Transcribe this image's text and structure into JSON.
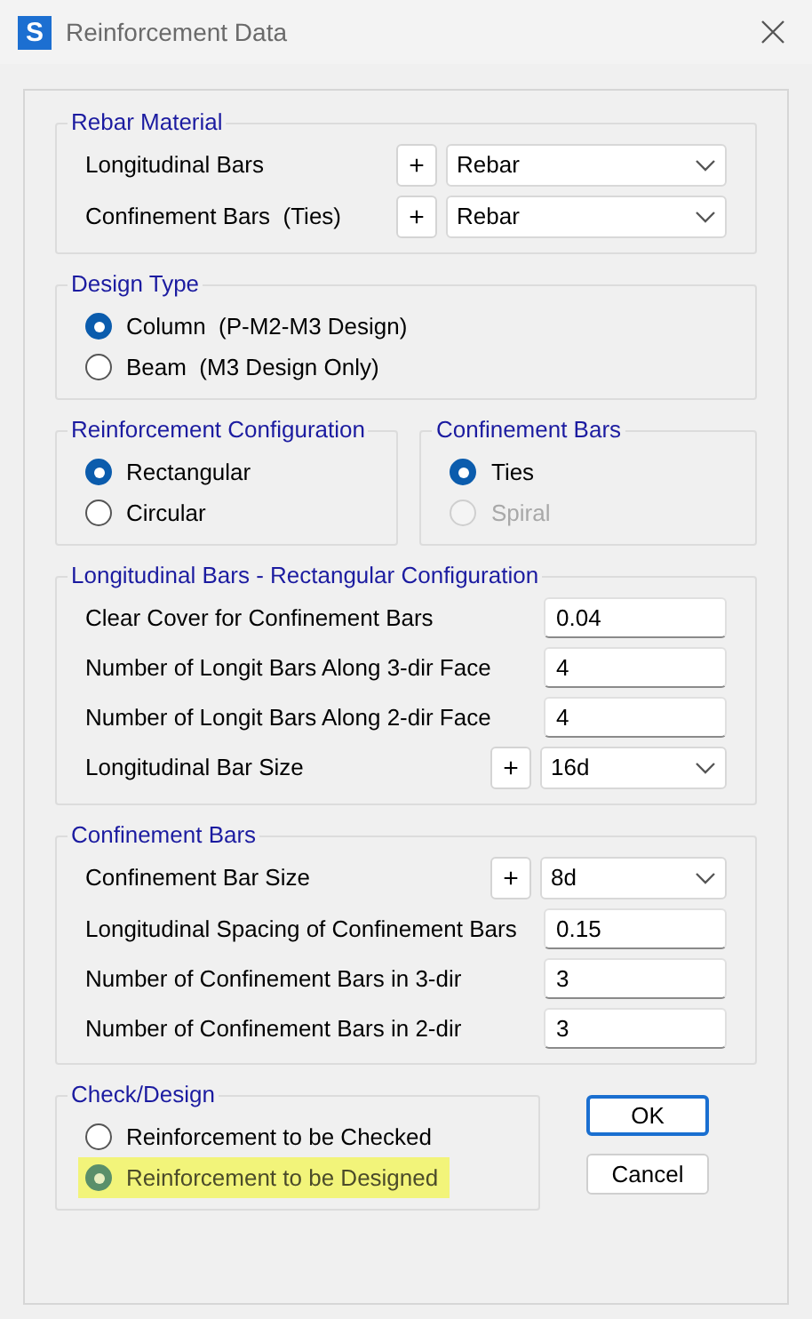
{
  "window": {
    "title": "Reinforcement Data",
    "icon_letter": "S"
  },
  "rebar_material": {
    "title": "Rebar Material",
    "rows": [
      {
        "kind": "dropdown",
        "label": "Longitudinal Bars",
        "add": "+",
        "value": "Rebar"
      },
      {
        "kind": "dropdown",
        "label": "Confinement Bars  (Ties)",
        "add": "+",
        "value": "Rebar"
      }
    ]
  },
  "design_type": {
    "title": "Design Type",
    "options": [
      {
        "label": "Column  (P-M2-M3 Design)",
        "selected": true,
        "disabled": false,
        "highlighted": false
      },
      {
        "label": "Beam  (M3 Design Only)",
        "selected": false,
        "disabled": false,
        "highlighted": false
      }
    ]
  },
  "reinforcement_configuration": {
    "title": "Reinforcement Configuration",
    "options": [
      {
        "label": "Rectangular",
        "selected": true,
        "disabled": false,
        "highlighted": false
      },
      {
        "label": "Circular",
        "selected": false,
        "disabled": false,
        "highlighted": false
      }
    ]
  },
  "confinement_type": {
    "title": "Confinement Bars",
    "options": [
      {
        "label": "Ties",
        "selected": true,
        "disabled": false,
        "highlighted": false
      },
      {
        "label": "Spiral",
        "selected": false,
        "disabled": true,
        "highlighted": false
      }
    ]
  },
  "longitudinal_bars": {
    "title": "Longitudinal Bars - Rectangular Configuration",
    "rows": [
      {
        "kind": "input",
        "label": "Clear Cover for Confinement Bars",
        "value": "0.04"
      },
      {
        "kind": "input",
        "label": "Number of Longit Bars Along 3-dir Face",
        "value": "4"
      },
      {
        "kind": "input",
        "label": "Number of Longit Bars Along 2-dir Face",
        "value": "4"
      },
      {
        "kind": "dropdown",
        "label": "Longitudinal Bar Size",
        "add": "+",
        "value": "16d"
      }
    ]
  },
  "confinement_bars": {
    "title": "Confinement Bars",
    "rows": [
      {
        "kind": "dropdown",
        "label": "Confinement Bar Size",
        "add": "+",
        "value": "8d"
      },
      {
        "kind": "input",
        "label": "Longitudinal Spacing of Confinement Bars",
        "value": "0.15"
      },
      {
        "kind": "input",
        "label": "Number of Confinement Bars in 3-dir",
        "value": "3"
      },
      {
        "kind": "input",
        "label": "Number of Confinement Bars in 2-dir",
        "value": "3"
      }
    ]
  },
  "check_design": {
    "title": "Check/Design",
    "options": [
      {
        "label": "Reinforcement to be Checked",
        "selected": false,
        "disabled": false,
        "highlighted": false
      },
      {
        "label": "Reinforcement to be Designed",
        "selected": true,
        "disabled": false,
        "highlighted": true
      }
    ]
  },
  "buttons": [
    {
      "label": "OK",
      "default": true
    },
    {
      "label": "Cancel",
      "default": false
    }
  ]
}
